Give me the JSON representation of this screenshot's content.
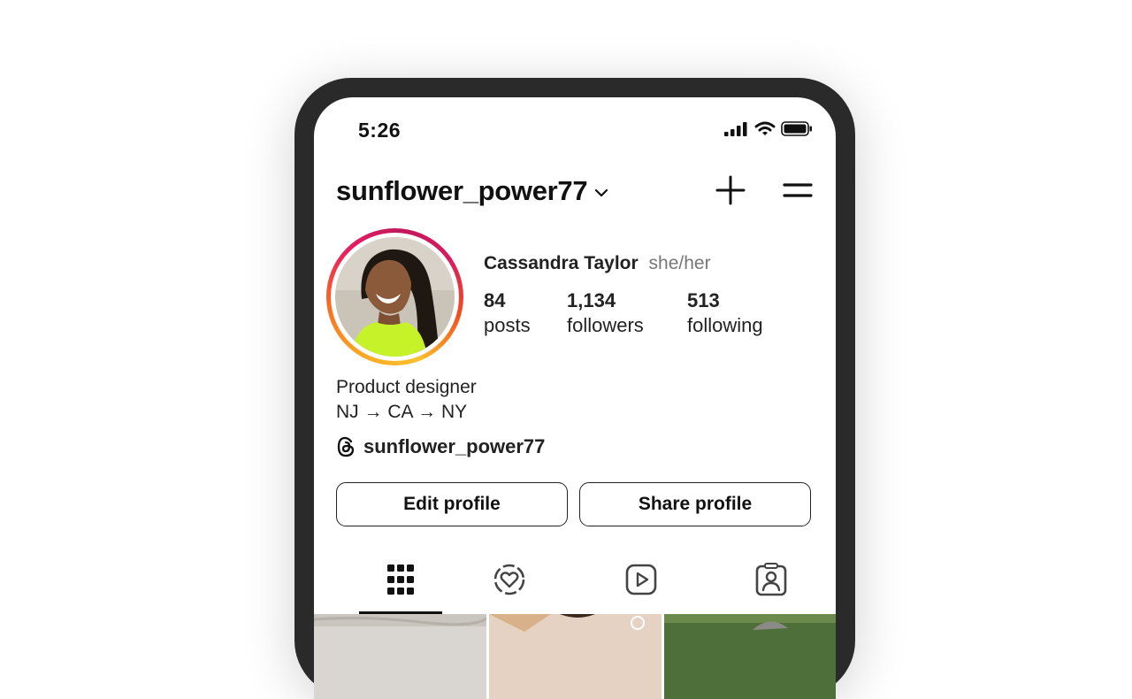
{
  "status_bar": {
    "time": "5:26"
  },
  "header": {
    "username": "sunflower_power77"
  },
  "profile": {
    "full_name": "Cassandra Taylor",
    "pronouns": "she/her",
    "stats": [
      {
        "value": "84",
        "label": "posts"
      },
      {
        "value": "1,134",
        "label": "followers"
      },
      {
        "value": "513",
        "label": "following"
      }
    ],
    "bio": [
      "Product designer",
      "NJ → CA → NY"
    ],
    "threads_handle": "sunflower_power77"
  },
  "actions": {
    "edit_label": "Edit profile",
    "share_label": "Share profile"
  },
  "tabs": [
    {
      "icon": "grid-icon",
      "active": true
    },
    {
      "icon": "reels-heart-icon",
      "active": false
    },
    {
      "icon": "video-play-icon",
      "active": false
    },
    {
      "icon": "tagged-person-icon",
      "active": false
    }
  ],
  "colors": {
    "ring_start": "#f9a825",
    "ring_mid": "#e91e63",
    "frame": "#2a2a2a",
    "avatar_top": "#c9c3b8",
    "avatar_shirt": "#c6f22a"
  }
}
